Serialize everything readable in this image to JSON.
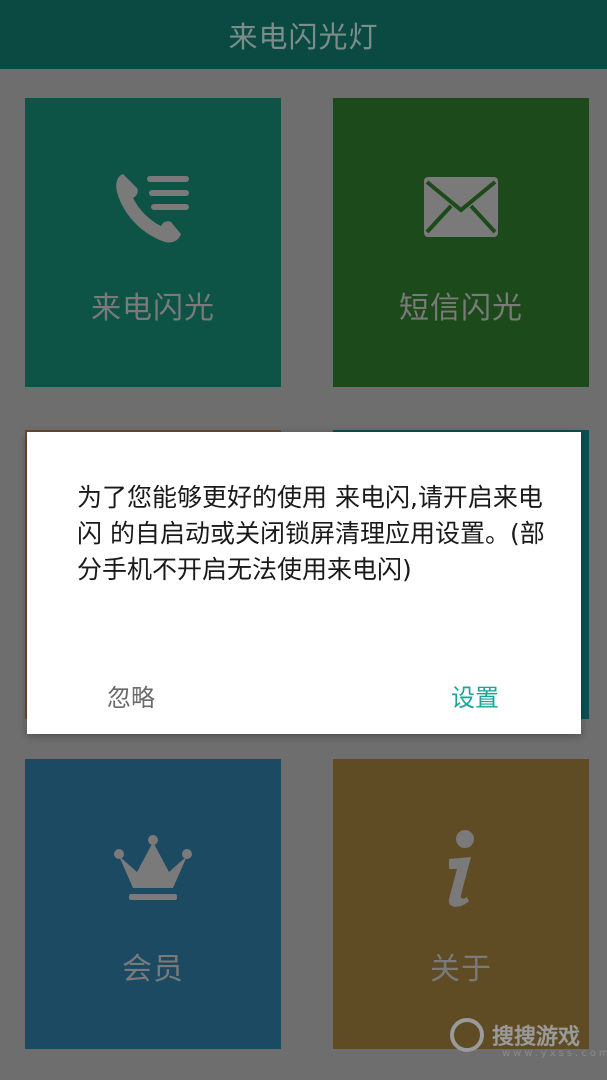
{
  "app": {
    "title": "来电闪光灯"
  },
  "tiles": {
    "call": {
      "label": "来电闪光",
      "icon": "phone-list-icon"
    },
    "sms": {
      "label": "短信闪光",
      "icon": "envelope-icon"
    },
    "vip": {
      "label": "会员",
      "icon": "crown-icon"
    },
    "about": {
      "label": "关于",
      "icon": "info-icon"
    }
  },
  "dialog": {
    "message": "为了您能够更好的使用 来电闪,请开启来电闪 的自启动或关闭锁屏清理应用设置。(部分手机不开启无法使用来电闪)",
    "ignore_label": "忽略",
    "settings_label": "设置"
  },
  "watermark": {
    "text": "搜搜游戏",
    "sub": "www.yxss.com"
  },
  "colors": {
    "titlebar": "#0a4a43",
    "accent": "#17a697",
    "tile_call": "#0d5346",
    "tile_sms": "#1d4a1a",
    "tile_vip": "#1b4a62",
    "tile_about": "#5f4c24"
  }
}
